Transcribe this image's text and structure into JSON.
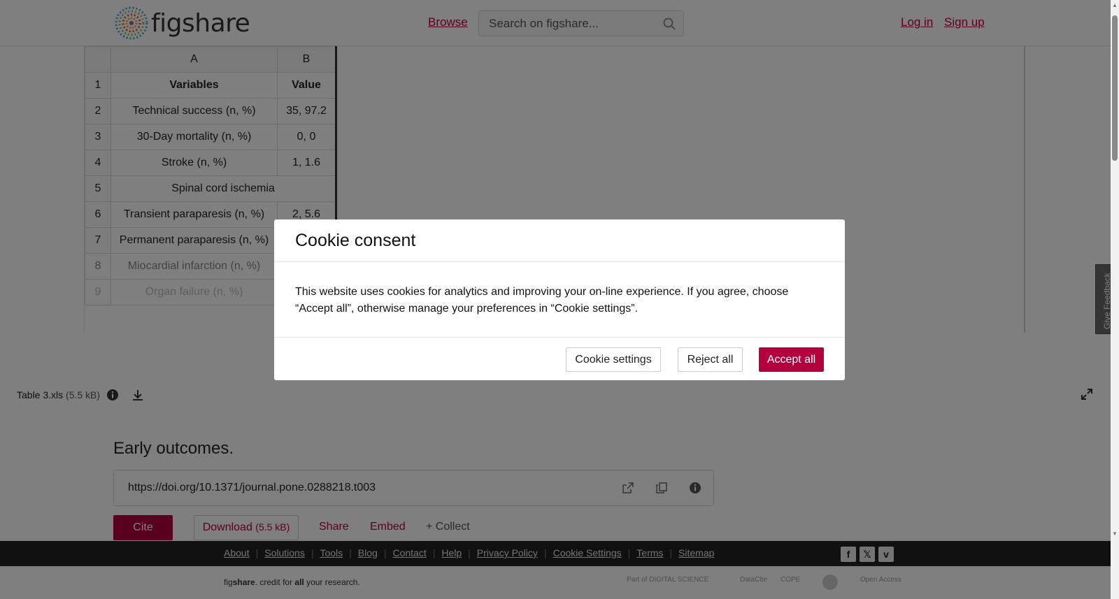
{
  "header": {
    "logo_text": "figshare",
    "browse_label": "Browse",
    "search_placeholder": "Search on figshare...",
    "login_label": "Log in",
    "signup_label": "Sign up"
  },
  "sheet": {
    "col_headers": [
      "A",
      "B"
    ],
    "rows": [
      {
        "n": "1",
        "a": "Variables",
        "b": "Value"
      },
      {
        "n": "2",
        "a": "Technical success (n, %)",
        "b": "35, 97.2"
      },
      {
        "n": "3",
        "a": "30-Day mortality (n, %)",
        "b": "0, 0"
      },
      {
        "n": "4",
        "a": "Stroke (n, %)",
        "b": "1, 1.6"
      },
      {
        "n": "5",
        "merged": "Spinal cord ischemia"
      },
      {
        "n": "6",
        "a": "Transient paraparesis (n, %)",
        "b": "2, 5.6"
      },
      {
        "n": "7",
        "a": "Permanent paraparesis (n, %)",
        "b": ""
      },
      {
        "n": "8",
        "a": "Miocardial infarction (n, %)",
        "b": ""
      },
      {
        "n": "9",
        "a": "Organ failure (n, %)",
        "b": ""
      }
    ]
  },
  "file": {
    "name": "Table 3.xls",
    "size": "(5.5 kB)"
  },
  "item": {
    "title": "Early outcomes.",
    "doi": "https://doi.org/10.1371/journal.pone.0288218.t003",
    "cite_label": "Cite",
    "download_label": "Download",
    "download_size": "(5.5 kB)",
    "share_label": "Share",
    "embed_label": "Embed",
    "collect_label": "+ Collect"
  },
  "footer": {
    "links": [
      "About",
      "Solutions",
      "Tools",
      "Blog",
      "Contact",
      "Help",
      "Privacy Policy",
      "Cookie Settings",
      "Terms",
      "Sitemap"
    ],
    "tagline_fig": "fig",
    "tagline_share": "share",
    "tagline_mid": ". credit for ",
    "tagline_all": "all",
    "tagline_end": " your research.",
    "partner_digital_science": "Part of DIGITAL SCIENCE",
    "partner_datacite": "DataCite",
    "partner_cope": "COPE",
    "partner_openaccess": "Open Access"
  },
  "cookie": {
    "title": "Cookie consent",
    "body": "This website uses cookies for analytics and improving your on-line experience. If you agree, choose “Accept all”, otherwise manage your preferences in “Cookie settings”.",
    "settings_label": "Cookie settings",
    "reject_label": "Reject all",
    "accept_label": "Accept all"
  },
  "feedback_label": "Give Feedback",
  "colors": {
    "brand": "#b5003e",
    "footer_bg": "#202020"
  }
}
